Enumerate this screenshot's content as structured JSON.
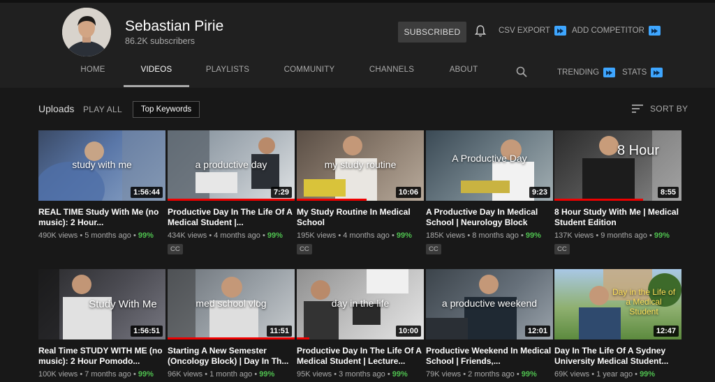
{
  "channel": {
    "name": "Sebastian Pirie",
    "subscribers": "86.2K subscribers",
    "subscribe_label": "SUBSCRIBED"
  },
  "extensions": {
    "csv_export": "CSV EXPORT",
    "add_competitor": "ADD COMPETITOR",
    "trending": "TRENDING",
    "stats": "STATS",
    "badge_color": "#3ea6ff"
  },
  "tabs": [
    {
      "label": "HOME"
    },
    {
      "label": "VIDEOS"
    },
    {
      "label": "PLAYLISTS"
    },
    {
      "label": "COMMUNITY"
    },
    {
      "label": "CHANNELS"
    },
    {
      "label": "ABOUT"
    }
  ],
  "toolbar": {
    "uploads": "Uploads",
    "play_all": "PLAY ALL",
    "top_keywords": "Top Keywords",
    "sort_by": "SORT BY"
  },
  "videos": [
    {
      "thumb_text": "study with me",
      "duration": "1:56:44",
      "title": "REAL TIME Study With Me (no music): 2 Hour...",
      "views": "490K views",
      "age": "5 months ago",
      "score": "99%",
      "cc": ""
    },
    {
      "thumb_text": "a productive day",
      "duration": "7:29",
      "title": "Productive Day In The Life Of A Medical Student |...",
      "views": "434K views",
      "age": "4 months ago",
      "score": "99%",
      "cc": "CC"
    },
    {
      "thumb_text": "my study routine",
      "duration": "10:06",
      "title": "My Study Routine In Medical School",
      "views": "195K views",
      "age": "4 months ago",
      "score": "99%",
      "cc": "CC"
    },
    {
      "thumb_text": "A Productive Day",
      "duration": "9:23",
      "title": "A Productive Day In Medical School | Neurology Block",
      "views": "185K views",
      "age": "8 months ago",
      "score": "99%",
      "cc": "CC"
    },
    {
      "thumb_text": "8 Hour",
      "duration": "8:55",
      "title": "8 Hour Study With Me | Medical Student Edition",
      "views": "137K views",
      "age": "9 months ago",
      "score": "99%",
      "cc": "CC"
    },
    {
      "thumb_text": "Study With Me",
      "duration": "1:56:51",
      "title": "Real Time STUDY WITH ME (no music): 2 Hour Pomodo...",
      "views": "100K views",
      "age": "7 months ago",
      "score": "99%",
      "cc": ""
    },
    {
      "thumb_text": "med school vlog",
      "duration": "11:51",
      "title": "Starting A New Semester (Oncology Block) | Day In Th...",
      "views": "96K views",
      "age": "1 month ago",
      "score": "99%",
      "cc": ""
    },
    {
      "thumb_text": "day in the life",
      "duration": "10:00",
      "title": "Productive Day In The Life Of A Medical Student | Lecture...",
      "views": "95K views",
      "age": "3 months ago",
      "score": "99%",
      "cc": ""
    },
    {
      "thumb_text": "a productive weekend",
      "duration": "12:01",
      "title": "Productive Weekend In Medical School | Friends,...",
      "views": "79K views",
      "age": "2 months ago",
      "score": "99%",
      "cc": ""
    },
    {
      "thumb_text": "Day in the Life of a Medical Student",
      "duration": "12:47",
      "title": "Day In The Life Of A Sydney University Medical Student...",
      "views": "69K views",
      "age": "1 year ago",
      "score": "99%",
      "cc": ""
    }
  ]
}
